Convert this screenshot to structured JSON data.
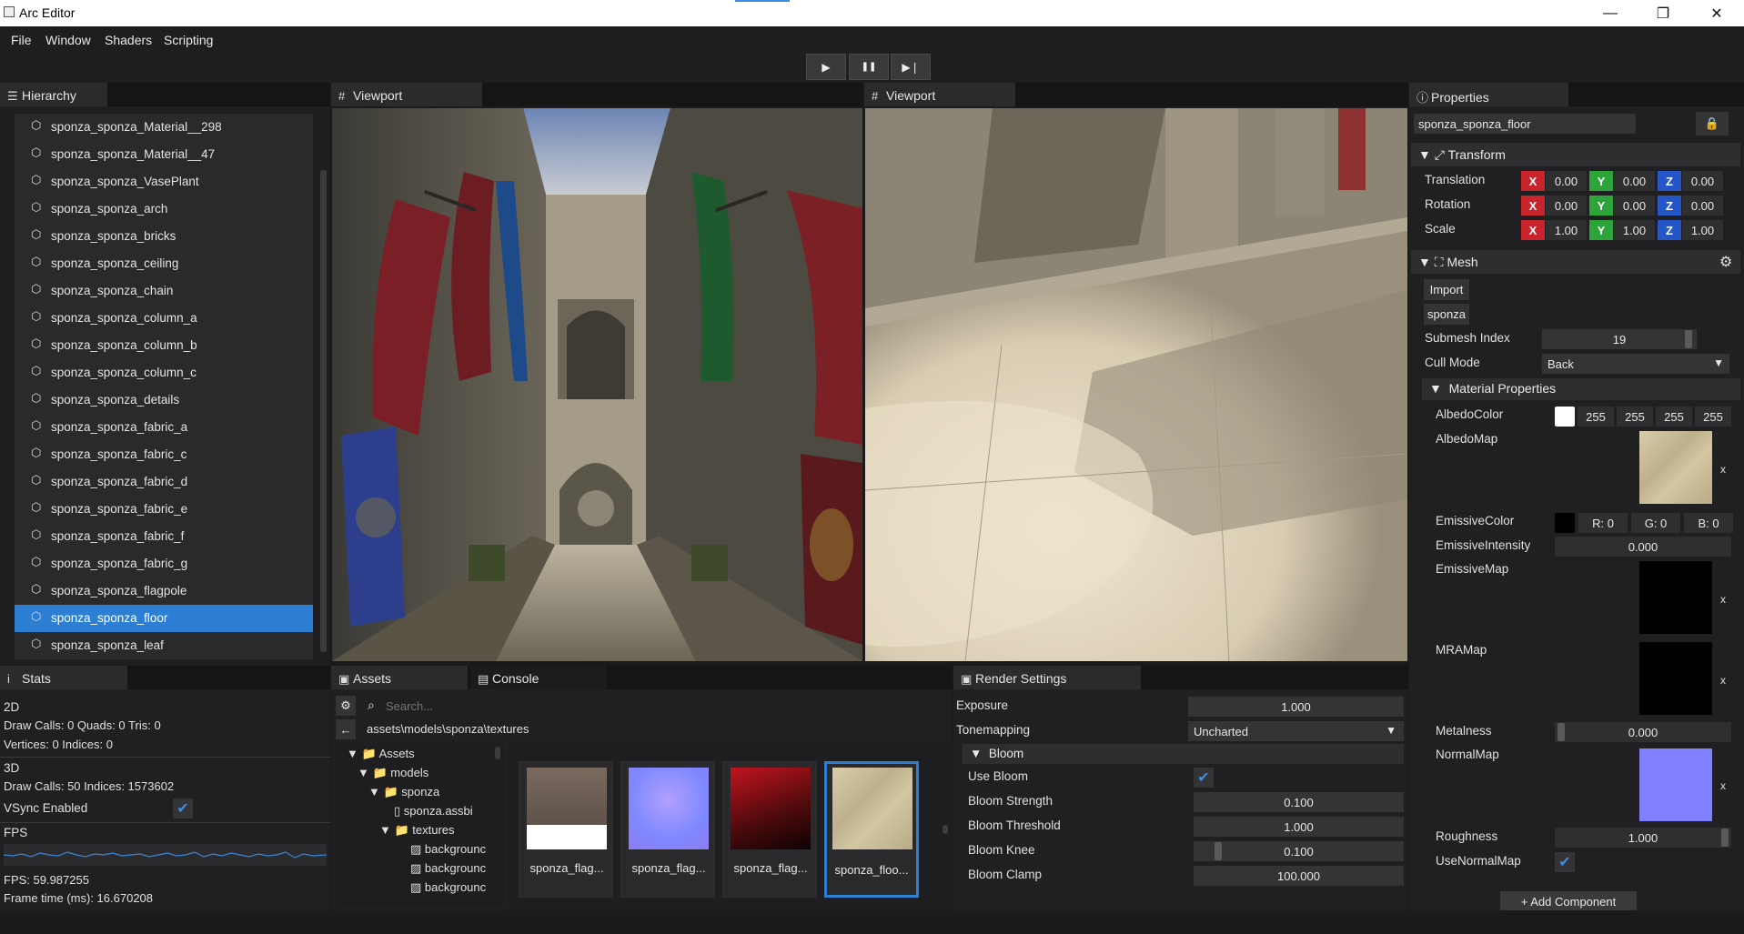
{
  "window": {
    "title": "Arc Editor",
    "controls": [
      "—",
      "❐",
      "✕"
    ]
  },
  "menu": [
    "File",
    "Window",
    "Shaders",
    "Scripting"
  ],
  "playback": {
    "play": "▶",
    "pause": "❚❚",
    "step": "▶❘"
  },
  "hierarchy": {
    "tab": "Hierarchy",
    "items": [
      "sponza_sponza_Material__298",
      "sponza_sponza_Material__47",
      "sponza_sponza_VasePlant",
      "sponza_sponza_arch",
      "sponza_sponza_bricks",
      "sponza_sponza_ceiling",
      "sponza_sponza_chain",
      "sponza_sponza_column_a",
      "sponza_sponza_column_b",
      "sponza_sponza_column_c",
      "sponza_sponza_details",
      "sponza_sponza_fabric_a",
      "sponza_sponza_fabric_c",
      "sponza_sponza_fabric_d",
      "sponza_sponza_fabric_e",
      "sponza_sponza_fabric_f",
      "sponza_sponza_fabric_g",
      "sponza_sponza_flagpole",
      "sponza_sponza_floor",
      "sponza_sponza_leaf"
    ],
    "selected": "sponza_sponza_floor"
  },
  "viewports": [
    {
      "tab": "Viewport"
    },
    {
      "tab": "Viewport"
    }
  ],
  "stats": {
    "tab": "Stats",
    "h2d": "2D",
    "draw2d": "Draw Calls: 0  Quads: 0  Tris: 0",
    "verts2d": "Vertices: 0  Indices: 0",
    "h3d": "3D",
    "draw3d": "Draw Calls: 50  Indices: 1573602",
    "vsync": "VSync Enabled",
    "vsync_on": true,
    "fps_label": "FPS",
    "fps": "FPS: 59.987255",
    "frametime": "Frame time (ms): 16.670208"
  },
  "assets": {
    "tab": "Assets",
    "console_tab": "Console",
    "search_placeholder": "Search...",
    "path": "assets\\models\\sponza\\textures",
    "tree": [
      "Assets",
      "models",
      "sponza",
      "sponza.assbi",
      "textures",
      "backgrounc",
      "backgrounc",
      "backgrounc"
    ],
    "thumbs": [
      "sponza_flag...",
      "sponza_flag...",
      "sponza_flag...",
      "sponza_floo..."
    ]
  },
  "render_settings": {
    "tab": "Render Settings",
    "exposure_label": "Exposure",
    "exposure": "1.000",
    "tonemapping_label": "Tonemapping",
    "tonemapping": "Uncharted",
    "bloom_header": "Bloom",
    "use_bloom_label": "Use Bloom",
    "use_bloom": true,
    "strength_label": "Bloom Strength",
    "strength": "0.100",
    "threshold_label": "Bloom Threshold",
    "threshold": "1.000",
    "knee_label": "Bloom Knee",
    "knee": "0.100",
    "clamp_label": "Bloom Clamp",
    "clamp": "100.000"
  },
  "properties": {
    "tab": "Properties",
    "entity_name": "sponza_sponza_floor",
    "transform_header": "Transform",
    "translation_label": "Translation",
    "translation": [
      "0.00",
      "0.00",
      "0.00"
    ],
    "rotation_label": "Rotation",
    "rotation": [
      "0.00",
      "0.00",
      "0.00"
    ],
    "scale_label": "Scale",
    "scale": [
      "1.00",
      "1.00",
      "1.00"
    ],
    "axes": [
      "X",
      "Y",
      "Z"
    ],
    "mesh_header": "Mesh",
    "import_label": "Import",
    "mesh_name": "sponza",
    "submesh_label": "Submesh Index",
    "submesh": "19",
    "cull_label": "Cull Mode",
    "cull": "Back",
    "material_header": "Material Properties",
    "albedo_color_label": "AlbedoColor",
    "albedo_color": [
      "255",
      "255",
      "255",
      "255"
    ],
    "albedo_map_label": "AlbedoMap",
    "emissive_color_label": "EmissiveColor",
    "emissive_color": [
      "R: 0",
      "G: 0",
      "B: 0"
    ],
    "emissive_intensity_label": "EmissiveIntensity",
    "emissive_intensity": "0.000",
    "emissive_map_label": "EmissiveMap",
    "mra_map_label": "MRAMap",
    "metalness_label": "Metalness",
    "metalness": "0.000",
    "normal_map_label": "NormalMap",
    "roughness_label": "Roughness",
    "roughness": "1.000",
    "use_normal_map_label": "UseNormalMap",
    "use_normal_map": true,
    "add_component": "+ Add Component",
    "remove": "x"
  },
  "colors": {
    "accent": "#2d7fd3",
    "axis_x": "#c9232c",
    "axis_y": "#2da43a",
    "axis_z": "#2456c8",
    "normal_map": "#8080ff"
  }
}
